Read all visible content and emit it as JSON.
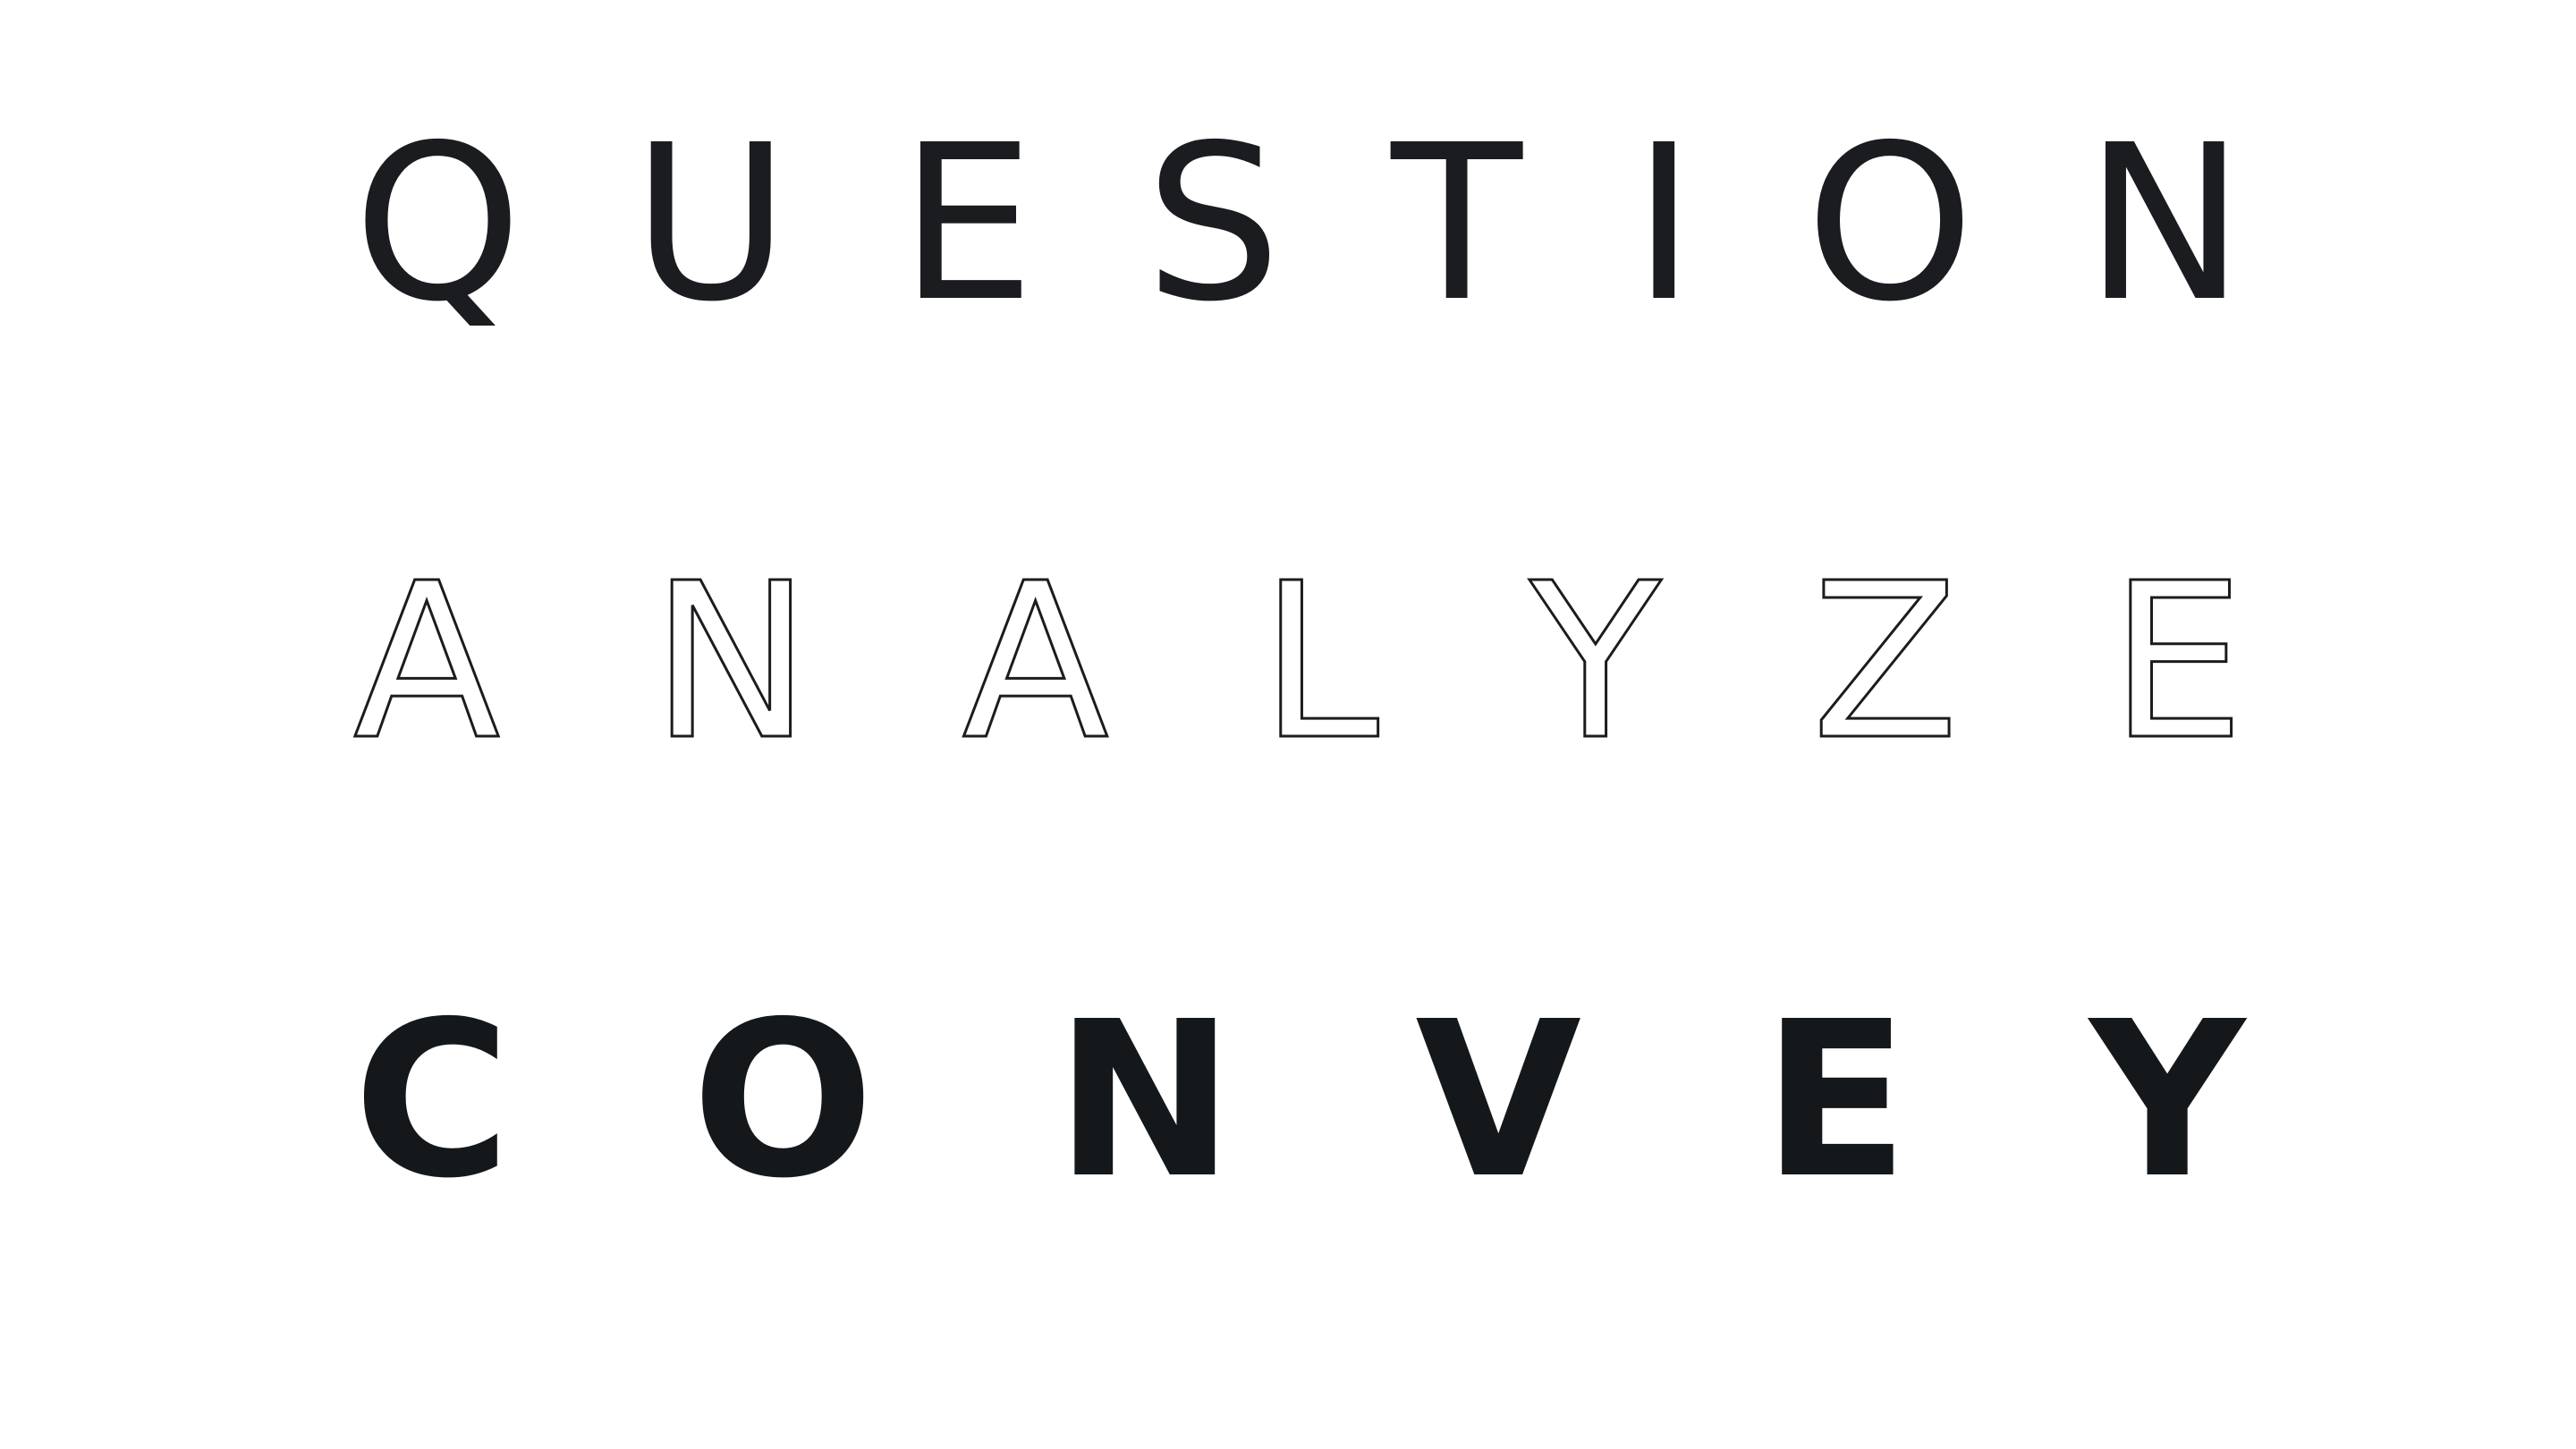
{
  "words": {
    "question": [
      "Q",
      "U",
      "E",
      "S",
      "T",
      "I",
      "O",
      "N"
    ],
    "analyze": [
      "A",
      "N",
      "A",
      "L",
      "Y",
      "Z",
      "E"
    ],
    "convey": [
      "C",
      "O",
      "N",
      "V",
      "E",
      "Y"
    ]
  },
  "colors": {
    "ink": "#1a1c1f",
    "background": "#ffffff"
  }
}
